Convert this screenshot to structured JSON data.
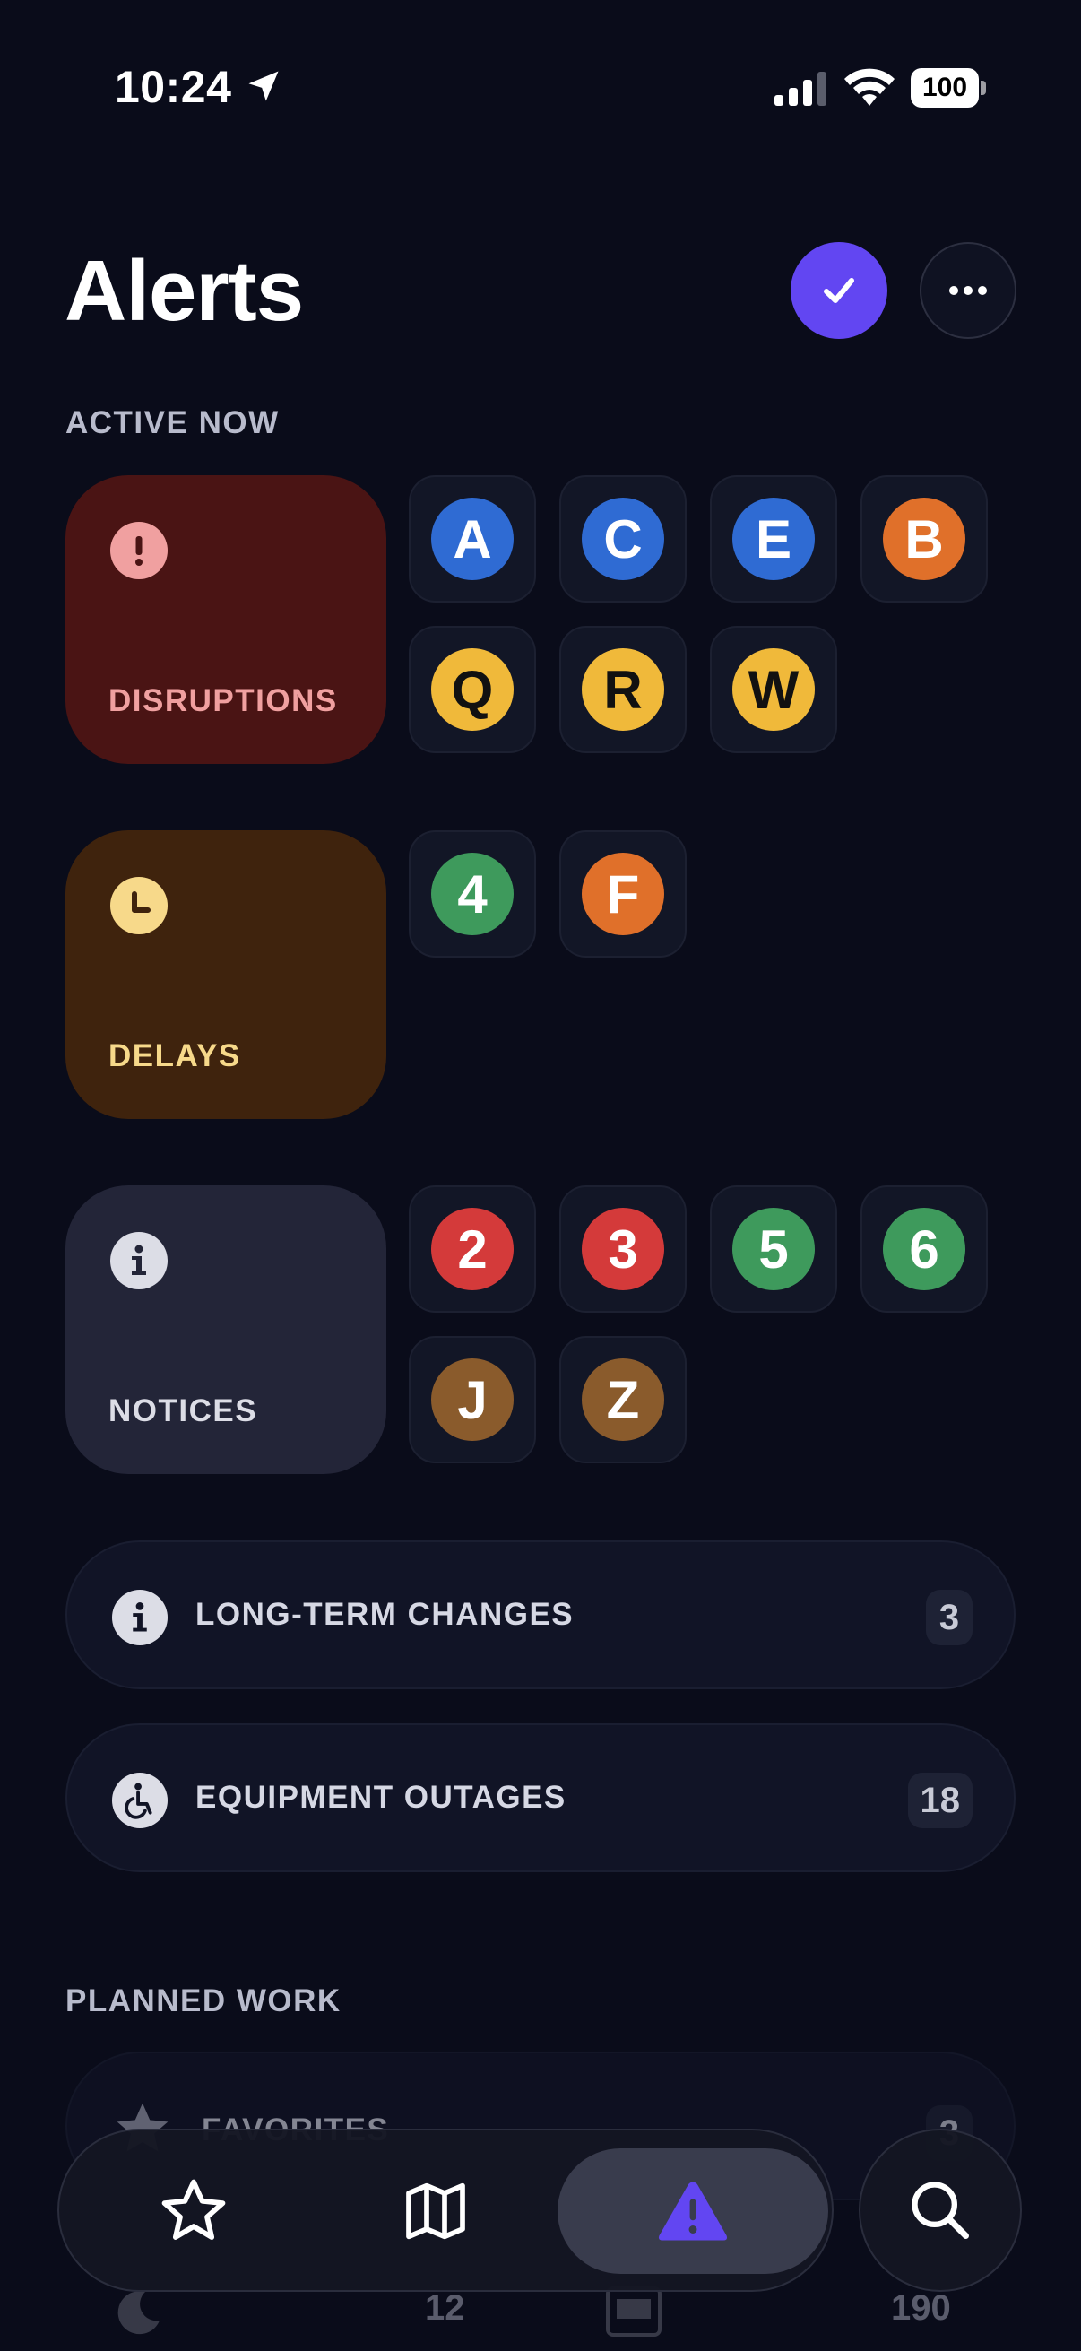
{
  "status": {
    "time": "10:24",
    "battery": "100"
  },
  "header": {
    "title": "Alerts"
  },
  "sections": {
    "active_now": "ACTIVE NOW",
    "planned_work": "PLANNED WORK"
  },
  "categories": [
    {
      "label": "DISRUPTIONS",
      "icon": "exclamation-icon",
      "routes": [
        "A",
        "C",
        "E",
        "B",
        "Q",
        "R",
        "W"
      ]
    },
    {
      "label": "DELAYS",
      "icon": "clock-icon",
      "routes": [
        "4",
        "F"
      ]
    },
    {
      "label": "NOTICES",
      "icon": "info-icon",
      "routes": [
        "2",
        "3",
        "5",
        "6",
        "J",
        "Z"
      ]
    }
  ],
  "rows": {
    "long_term": {
      "label": "LONG-TERM CHANGES",
      "count": "3"
    },
    "equipment": {
      "label": "EQUIPMENT OUTAGES",
      "count": "18"
    }
  },
  "planned": {
    "favorites": {
      "label": "FAVORITES",
      "count": "3"
    },
    "partial_counts": [
      "12",
      "190"
    ]
  },
  "colors": {
    "accent": "#6246f2",
    "disruption_bg": "#4a1414",
    "delay_bg": "#3f230d",
    "notice_bg": "#232538",
    "line_blue": "#2f6bd3",
    "line_orange": "#e0702a",
    "line_yellow": "#f0b93a",
    "line_green": "#3e9a5c",
    "line_red": "#d43a3a",
    "line_brown": "#8a5b2c"
  },
  "tabs": [
    "favorites-tab",
    "map-tab",
    "alerts-tab",
    "search-tab"
  ]
}
